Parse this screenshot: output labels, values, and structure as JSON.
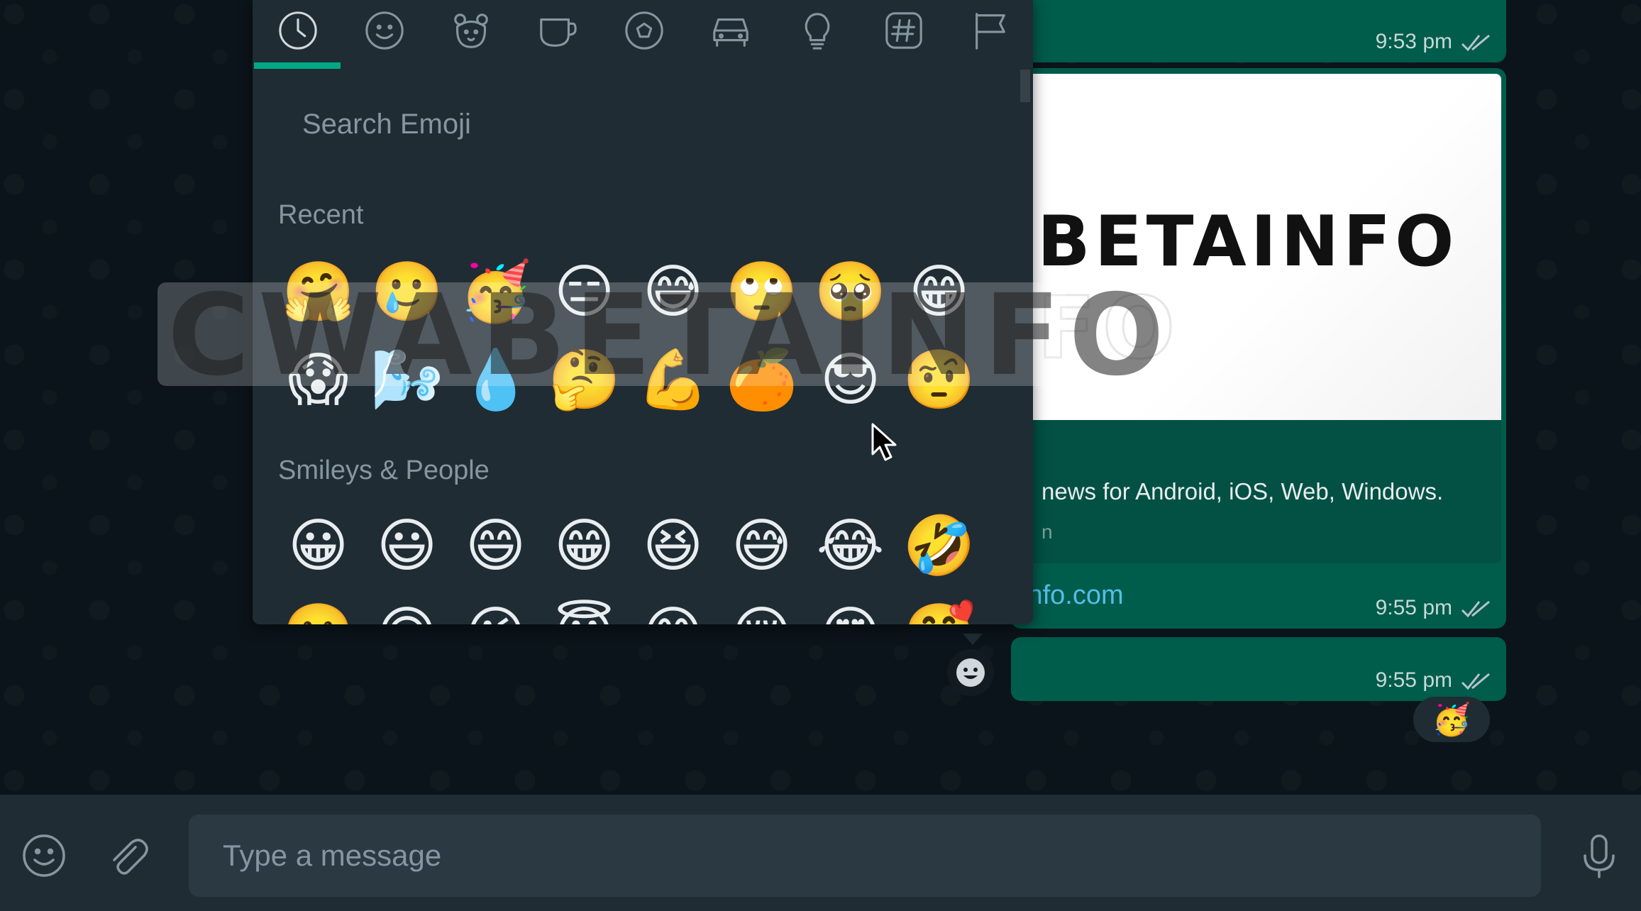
{
  "emoji_panel": {
    "categories": [
      "recent-icon",
      "smileys-icon",
      "animals-icon",
      "food-icon",
      "activity-icon",
      "travel-icon",
      "objects-icon",
      "symbols-icon",
      "flags-icon"
    ],
    "search_placeholder": "Search Emoji",
    "recent_title": "Recent",
    "recent_emojis": [
      "🤗",
      "🥲",
      "🥳",
      "😑",
      "😅",
      "🙄",
      "🥺",
      "😁",
      "😱",
      "🌬️",
      "💧",
      "🤔",
      "💪",
      "🍊",
      "😎",
      "🤨"
    ],
    "smileys_title": "Smileys & People",
    "smileys_emojis": [
      "😀",
      "😃",
      "😄",
      "😁",
      "😆",
      "😅",
      "😂",
      "🤣",
      "🙂",
      "🙃",
      "😉",
      "😇",
      "😊",
      "😌",
      "😍",
      "🥰"
    ]
  },
  "messages": {
    "msg1_time": "9:53 pm",
    "preview_brand": "BETAINFO",
    "preview_brand_outline": "FO",
    "preview_description": "news for Android, iOS, Web, Windows.",
    "preview_sub": "n",
    "link_text": "info.com",
    "msg2_time": "9:55 pm",
    "msg3_time": "9:55 pm",
    "reaction_emoji": "🥳",
    "react_button_glyph": "☻"
  },
  "watermark": {
    "text": "CWABETAINFO"
  },
  "composer": {
    "placeholder": "Type a message"
  },
  "colors": {
    "accent": "#00a884",
    "bubble": "#005c4b",
    "link": "#53bdeb"
  }
}
